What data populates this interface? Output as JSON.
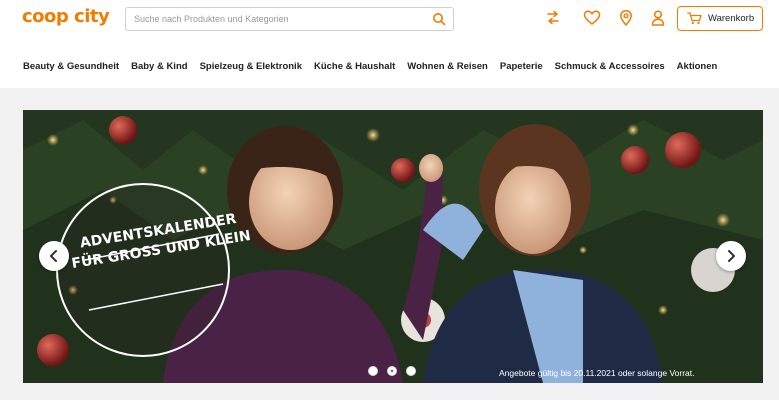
{
  "brand": {
    "logo": "coop city",
    "accent": "#f07c00"
  },
  "search": {
    "placeholder": "Suche nach Produkten und Kategorien",
    "icon": "search-icon"
  },
  "header_icons": [
    "swap-icon",
    "heart-icon",
    "location-pin-icon",
    "user-icon"
  ],
  "cart": {
    "label": "Warenkorb",
    "icon": "cart-icon"
  },
  "nav": {
    "items": [
      {
        "label": "Beauty & Gesundheit"
      },
      {
        "label": "Baby & Kind"
      },
      {
        "label": "Spielzeug & Elektronik"
      },
      {
        "label": "Küche & Haushalt"
      },
      {
        "label": "Wohnen & Reisen"
      },
      {
        "label": "Papeterie"
      },
      {
        "label": "Schmuck & Accessoires"
      },
      {
        "label": "Aktionen"
      }
    ]
  },
  "hero": {
    "headline_line1": "ADVENTSKALENDER",
    "headline_line2": "FÜR GROSS UND KLEIN",
    "validity": "Angebote gültig bis 20.11.2021 oder solange Vorrat.",
    "slides_count": 3,
    "active_slide": 2,
    "prev_icon": "chevron-left-icon",
    "next_icon": "chevron-right-icon"
  }
}
